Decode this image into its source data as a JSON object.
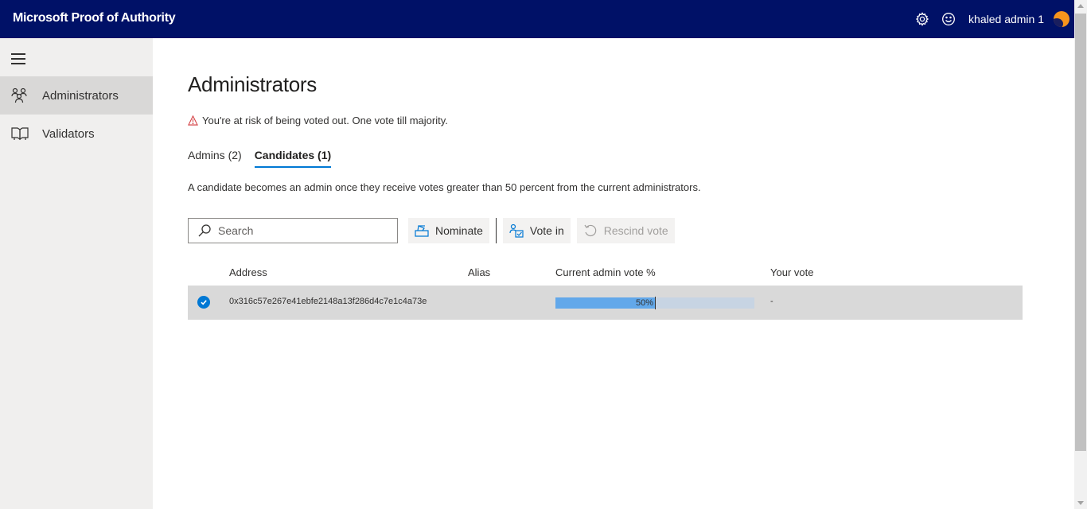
{
  "header": {
    "app_title": "Microsoft Proof of Authority",
    "user_name": "khaled admin 1",
    "settings_icon": "gear-icon",
    "feedback_icon": "smiley-icon",
    "avatar_color": "#f7941d",
    "bar_color": "#001167"
  },
  "sidebar": {
    "menu_icon": "hamburger-icon",
    "items": [
      {
        "label": "Administrators",
        "icon": "people-icon",
        "active": true
      },
      {
        "label": "Validators",
        "icon": "book-icon",
        "active": false
      }
    ]
  },
  "main": {
    "title": "Administrators",
    "warning": {
      "icon": "warning-icon",
      "text": "You're at risk of being voted out. One vote till majority."
    },
    "tabs": [
      {
        "label": "Admins (2)",
        "active": false
      },
      {
        "label": "Candidates (1)",
        "active": true
      }
    ],
    "description": "A candidate becomes an admin once they receive votes greater than 50 percent from the current administrators.",
    "search": {
      "placeholder": "Search",
      "value": ""
    },
    "buttons": {
      "nominate": "Nominate",
      "vote_in": "Vote in",
      "rescind_vote": "Rescind vote"
    },
    "table": {
      "columns": [
        "Address",
        "Alias",
        "Current admin vote %",
        "Your vote"
      ],
      "rows": [
        {
          "selected": true,
          "address": "0x316c57e267e41ebfe2148a13f286d4c7e1c4a73e",
          "alias": "",
          "vote_percent": 50,
          "vote_label": "50%",
          "your_vote": "-"
        }
      ]
    }
  },
  "colors": {
    "accent": "#0078d4",
    "progress_fill": "#62a8ea",
    "progress_track": "#c7d4e3",
    "warning": "#d13438"
  }
}
